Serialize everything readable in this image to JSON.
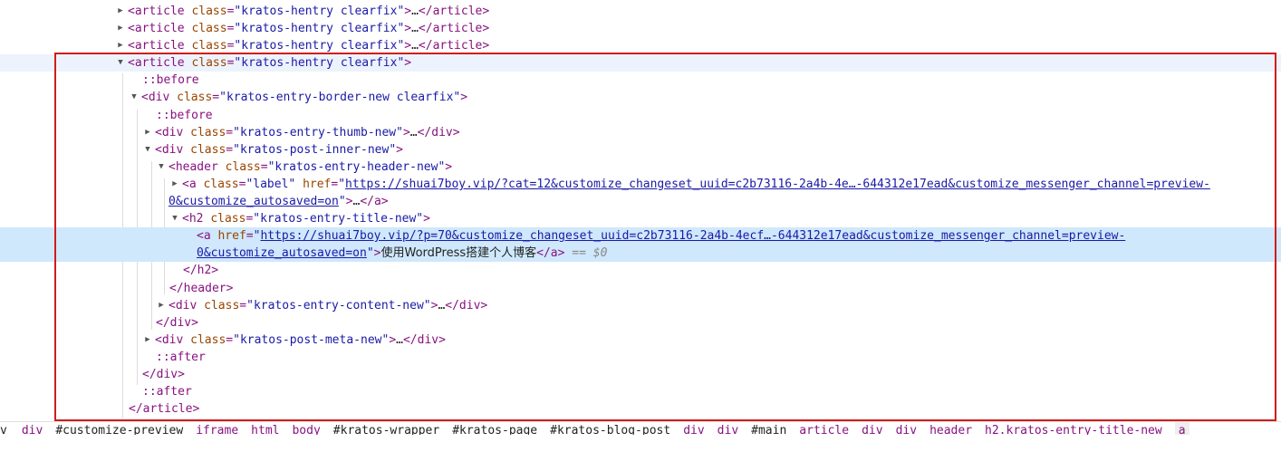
{
  "tree": {
    "rows": [
      {
        "open": "<",
        "tag": "article",
        "attr": "class",
        "eq": "=",
        "q1": "\"",
        "val": "kratos-hentry clearfix",
        "q2": "\"",
        "gt": ">",
        "ell": "…",
        "close": "</article>"
      },
      {
        "open": "<",
        "tag": "article",
        "attr": "class",
        "eq": "=",
        "q1": "\"",
        "val": "kratos-hentry clearfix",
        "q2": "\"",
        "gt": ">",
        "ell": "…",
        "close": "</article>"
      },
      {
        "open": "<",
        "tag": "article",
        "attr": "class",
        "eq": "=",
        "q1": "\"",
        "val": "kratos-hentry clearfix",
        "q2": "\"",
        "gt": ">",
        "ell": "…",
        "close": "</article>"
      },
      {
        "open": "<",
        "tag": "article",
        "attr": "class",
        "eq": "=",
        "q1": "\"",
        "val": "kratos-hentry clearfix",
        "q2": "\"",
        "gt": ">"
      },
      {
        "pseudo": "::before"
      },
      {
        "open": "<",
        "tag": "div",
        "attr": "class",
        "eq": "=",
        "q1": "\"",
        "val": "kratos-entry-border-new clearfix",
        "q2": "\"",
        "gt": ">"
      },
      {
        "pseudo": "::before"
      },
      {
        "open": "<",
        "tag": "div",
        "attr": "class",
        "eq": "=",
        "q1": "\"",
        "val": "kratos-entry-thumb-new",
        "q2": "\"",
        "gt": ">",
        "ell": "…",
        "close": "</div>"
      },
      {
        "open": "<",
        "tag": "div",
        "attr": "class",
        "eq": "=",
        "q1": "\"",
        "val": "kratos-post-inner-new",
        "q2": "\"",
        "gt": ">"
      },
      {
        "open": "<",
        "tag": "header",
        "attr": "class",
        "eq": "=",
        "q1": "\"",
        "val": "kratos-entry-header-new",
        "q2": "\"",
        "gt": ">"
      },
      {
        "open": "<",
        "tag": "a",
        "attr": "class",
        "eq": "=",
        "q1": "\"",
        "val": "label",
        "q2": "\"",
        "attr2": "href",
        "eq2": "=",
        "q3": "\"",
        "href": "https://shuai7boy.vip/?cat=12&customize_changeset_uuid=c2b73116-2a4b-4e…-644312e17ead&customize_messenger_channel=preview-"
      },
      {
        "href": "0&customize_autosaved=on",
        "q2": "\"",
        "gt": ">",
        "ell": "…",
        "close": "</a>"
      },
      {
        "open": "<",
        "tag": "h2",
        "attr": "class",
        "eq": "=",
        "q1": "\"",
        "val": "kratos-entry-title-new",
        "q2": "\"",
        "gt": ">"
      },
      {
        "open": "<",
        "tag": "a",
        "attr": "href",
        "eq": "=",
        "q1": "\"",
        "href": "https://shuai7boy.vip/?p=70&customize_changeset_uuid=c2b73116-2a4b-4ecf…-644312e17ead&customize_messenger_channel=preview-"
      },
      {
        "href": "0&customize_autosaved=on",
        "q2": "\"",
        "gt": ">",
        "text": "使用WordPress搭建个人博客",
        "close": "</a>",
        "dollar": " == $0"
      },
      {
        "close": "</h2>"
      },
      {
        "close": "</header>"
      },
      {
        "open": "<",
        "tag": "div",
        "attr": "class",
        "eq": "=",
        "q1": "\"",
        "val": "kratos-entry-content-new",
        "q2": "\"",
        "gt": ">",
        "ell": "…",
        "close": "</div>"
      },
      {
        "close": "</div>"
      },
      {
        "open": "<",
        "tag": "div",
        "attr": "class",
        "eq": "=",
        "q1": "\"",
        "val": "kratos-post-meta-new",
        "q2": "\"",
        "gt": ">",
        "ell": "…",
        "close": "</div>"
      },
      {
        "pseudo": "::after"
      },
      {
        "close": "</div>"
      },
      {
        "pseudo": "::after"
      },
      {
        "close": "</article>"
      }
    ]
  },
  "breadcrumbs": [
    "v",
    "div",
    "#customize-preview",
    "iframe",
    "html",
    "body",
    "#kratos-wrapper",
    "#kratos-page",
    "#kratos-blog-post",
    "div",
    "div",
    "#main",
    "article",
    "div",
    "div",
    "header",
    "h2.kratos-entry-title-new",
    "a"
  ],
  "colors": {
    "tag": "#881280",
    "attribute": "#994500",
    "value": "#1a1aa6",
    "selection": "#cfe8fc",
    "hover": "#edf3fc",
    "highlight_box": "#d11b1b"
  },
  "icons": {
    "collapsed": "triangle-right-icon",
    "expanded": "triangle-down-icon"
  }
}
